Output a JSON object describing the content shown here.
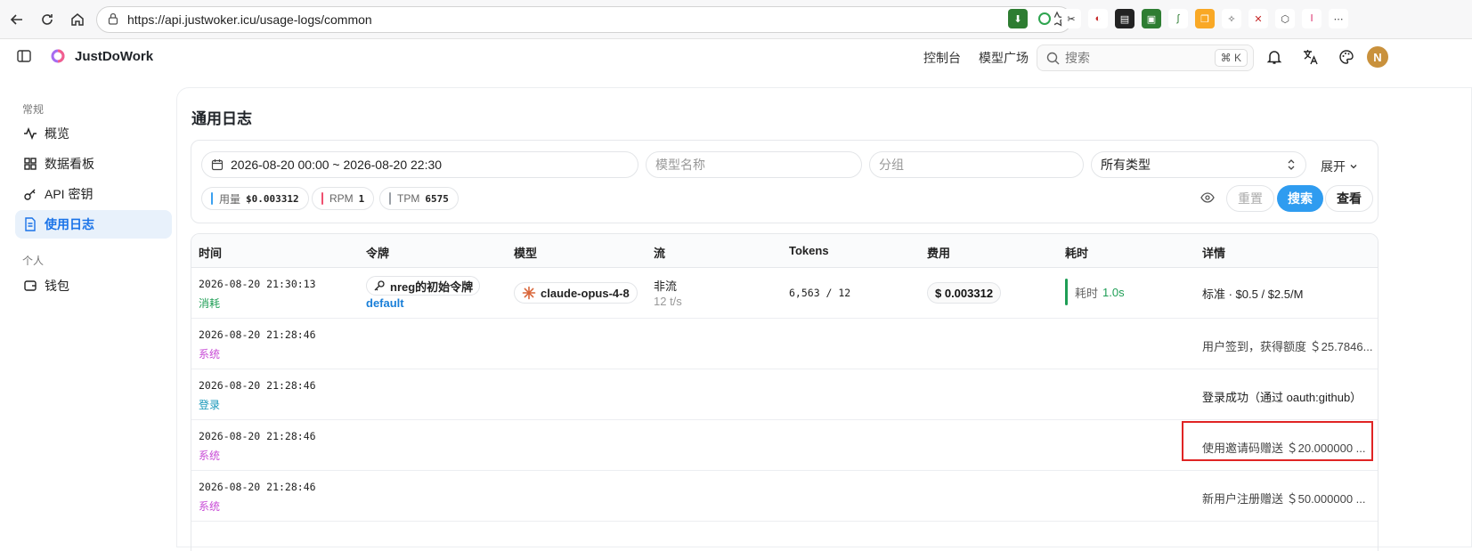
{
  "browser": {
    "url": "https://api.justwoker.icu/usage-logs/common"
  },
  "header": {
    "brand": "JustDoWork",
    "links": [
      "控制台",
      "模型广场"
    ],
    "search_placeholder": "搜索",
    "search_shortcut": "⌘ K",
    "avatar_letter": "N"
  },
  "sidebar": {
    "section_general": "常规",
    "section_personal": "个人",
    "items": [
      {
        "label": "概览"
      },
      {
        "label": "数据看板"
      },
      {
        "label": "API 密钥"
      },
      {
        "label": "使用日志"
      },
      {
        "label": "钱包"
      }
    ]
  },
  "page": {
    "title": "通用日志"
  },
  "filters": {
    "date_range": "2026-08-20 00:00 ~ 2026-08-20 22:30",
    "model_placeholder": "模型名称",
    "group_placeholder": "分组",
    "type_select": "所有类型",
    "expand": "展开",
    "stats": [
      {
        "label": "用量",
        "value": "$0.003312",
        "color": "#3aa0f0"
      },
      {
        "label": "RPM",
        "value": "1",
        "color": "#ef4f6f"
      },
      {
        "label": "TPM",
        "value": "6575",
        "color": "#9aa0a6"
      }
    ],
    "reset": "重置",
    "search": "搜索",
    "view": "查看"
  },
  "table": {
    "columns": [
      "时间",
      "令牌",
      "模型",
      "流",
      "Tokens",
      "费用",
      "耗时",
      "详情"
    ],
    "rows": [
      {
        "time": "2026-08-20 21:30:13",
        "tag": "消耗",
        "token": "nreg的初始令牌",
        "group": "default",
        "model": "claude-opus-4-8",
        "stream": "非流",
        "speed": "12 t/s",
        "tokens": "6,563 / 12",
        "cost": "$ 0.003312",
        "duration_label": "耗时",
        "duration_value": "1.0s",
        "detail": "标准 · $0.5 / $2.5/M"
      },
      {
        "time": "2026-08-20 21:28:46",
        "tag": "系统",
        "detail": "用户签到，获得额度 ＄25.7846..."
      },
      {
        "time": "2026-08-20 21:28:46",
        "tag": "登录",
        "detail": "登录成功（通过 oauth:github）"
      },
      {
        "time": "2026-08-20 21:28:46",
        "tag": "系统",
        "detail": "使用邀请码赠送 ＄20.000000 ..."
      },
      {
        "time": "2026-08-20 21:28:46",
        "tag": "系统",
        "detail": "新用户注册赠送 ＄50.000000 ..."
      }
    ]
  }
}
